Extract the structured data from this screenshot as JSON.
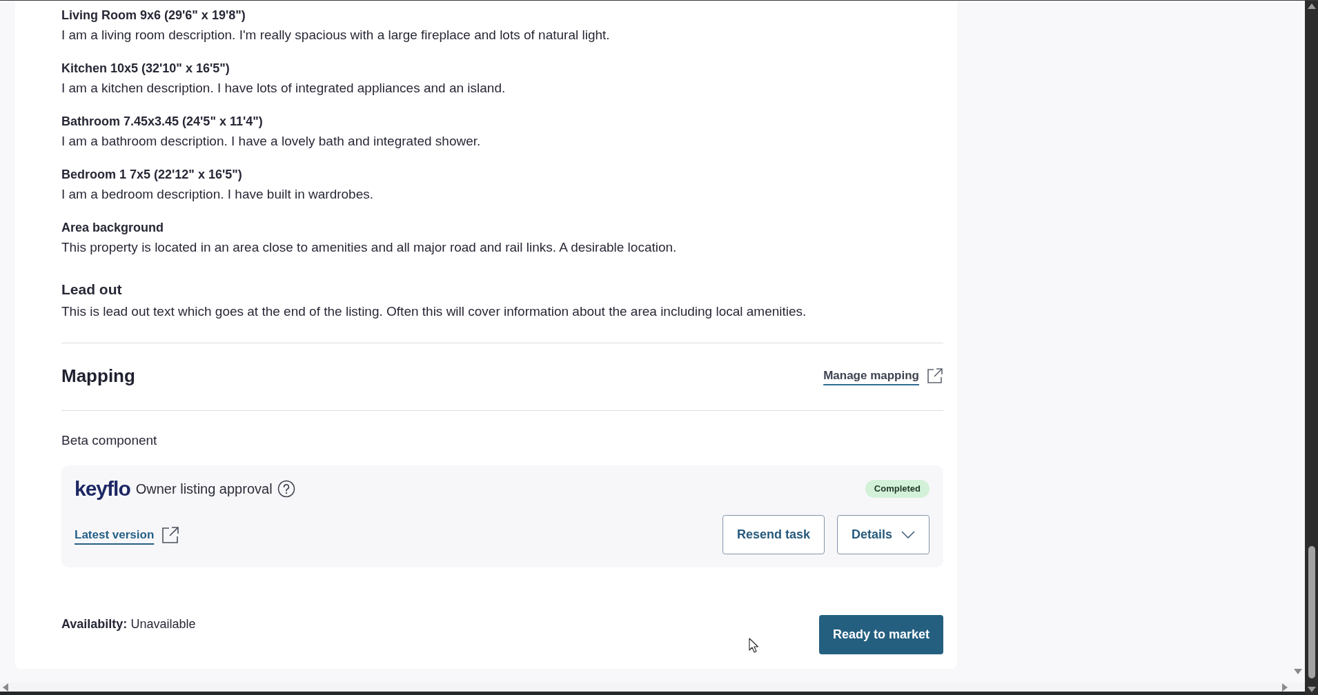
{
  "details": [
    {
      "kind": "item",
      "heading": "Living Room 9x6 (29'6\" x 19'8\")",
      "text": "I am a living room description. I'm really spacious with a large fireplace and lots of natural light."
    },
    {
      "kind": "item",
      "heading": "Kitchen 10x5 (32'10\" x 16'5\")",
      "text": "I am a kitchen description. I have lots of integrated appliances and an island."
    },
    {
      "kind": "item",
      "heading": "Bathroom 7.45x3.45 (24'5\" x 11'4\")",
      "text": "I am a bathroom description. I have a lovely bath and integrated shower."
    },
    {
      "kind": "item",
      "heading": "Bedroom 1 7x5 (22'12\" x 16'5\")",
      "text": "I am a bedroom description. I have built in wardrobes."
    },
    {
      "kind": "item",
      "heading": "Area background",
      "text": "This property is located in an area close to amenities and all major road and rail links. A desirable location."
    },
    {
      "kind": "lead",
      "heading": "Lead out",
      "text": "This is lead out text which goes at the end of the listing. Often this will cover information about the area including local amenities."
    }
  ],
  "mapping": {
    "title": "Mapping",
    "link": "Manage mapping"
  },
  "beta_label": "Beta component",
  "approval_card": {
    "logo": "keyflo",
    "title": "Owner listing approval",
    "status": "Completed",
    "link": "Latest version",
    "buttons": [
      {
        "kind": "plain",
        "label": "Resend task"
      },
      {
        "kind": "dropdown",
        "label": "Details",
        "expanded": false
      }
    ]
  },
  "availability": "**Availabilty:** Unavailable",
  "primary_button": "Ready to market"
}
